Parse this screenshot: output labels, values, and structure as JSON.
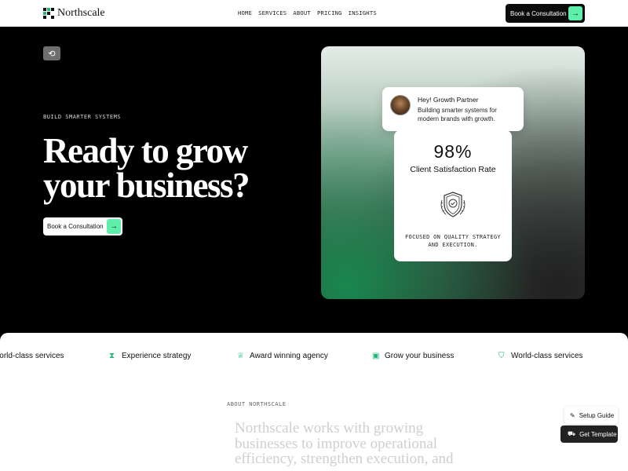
{
  "header": {
    "logo_text": "Northscale",
    "nav": [
      "HOME",
      "SERVICES",
      "ABOUT",
      "PRICING",
      "INSIGHTS"
    ],
    "cta_label": "Book a Consultation"
  },
  "hero": {
    "eyebrow": "BUILD SMARTER SYSTEMS",
    "title_line1": "Ready to grow",
    "title_line2": "your business?",
    "cta_label": "Book a Consultation",
    "accent_color": "#5ef0aa"
  },
  "profile": {
    "name": "Hey! Growth Partner",
    "description": "Building smarter systems for modern brands with growth."
  },
  "stat": {
    "value": "98%",
    "label": "Client Satisfaction Rate",
    "footer": "FOCUSED ON QUALITY STRATEGY AND EXECUTION."
  },
  "marquee": {
    "items": [
      {
        "label": "World-class services",
        "icon": "shield-check-icon"
      },
      {
        "label": "Experience strategy",
        "icon": "hourglass-icon"
      },
      {
        "label": "Award winning agency",
        "icon": "trophy-icon"
      },
      {
        "label": "Grow your business",
        "icon": "briefcase-icon"
      },
      {
        "label": "World-class services",
        "icon": "shield-check-icon"
      }
    ]
  },
  "about": {
    "eyebrow": "ABOUT NORTHSCALE",
    "text": "Northscale works with growing businesses to improve operational efficiency, strengthen execution, and"
  },
  "floating": {
    "setup_label": "Setup Guide",
    "template_label": "Get Template"
  }
}
